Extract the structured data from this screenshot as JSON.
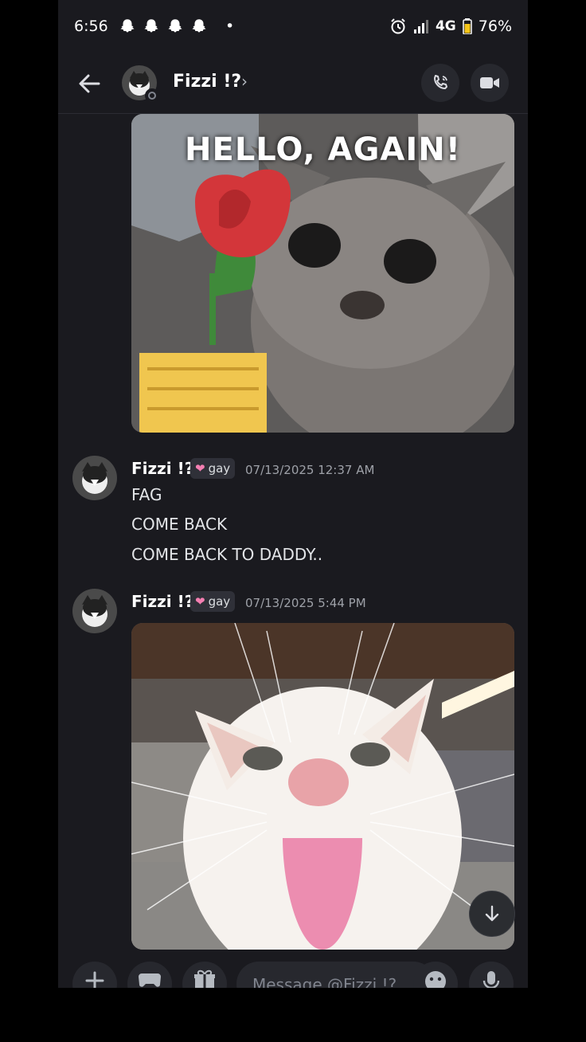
{
  "status_bar": {
    "time": "6:56",
    "notification_icons": [
      "snapchat-ghost-icon",
      "snapchat-ghost-icon",
      "snapchat-ghost-icon",
      "snapchat-ghost-icon"
    ],
    "dot": "•",
    "network": "4G",
    "battery": "76%"
  },
  "header": {
    "name": "Fizzi !?",
    "chevron": "›"
  },
  "gif": {
    "caption": "HELLO, AGAIN!"
  },
  "messages": [
    {
      "author": "Fizzi !?",
      "tag": "gay",
      "timestamp": "07/13/2025 12:37 AM",
      "lines": [
        "FAG",
        "COME BACK",
        "COME BACK TO DADDY.."
      ]
    },
    {
      "author": "Fizzi !?",
      "tag": "gay",
      "timestamp": "07/13/2025 5:44 PM",
      "lines": []
    }
  ],
  "composer": {
    "placeholder": "Message @Fizzi !?"
  },
  "colors": {
    "background": "#1a1a1f",
    "button": "#27282e",
    "tag_heart": "#f47fb2",
    "timestamp": "#9ea1a8"
  }
}
